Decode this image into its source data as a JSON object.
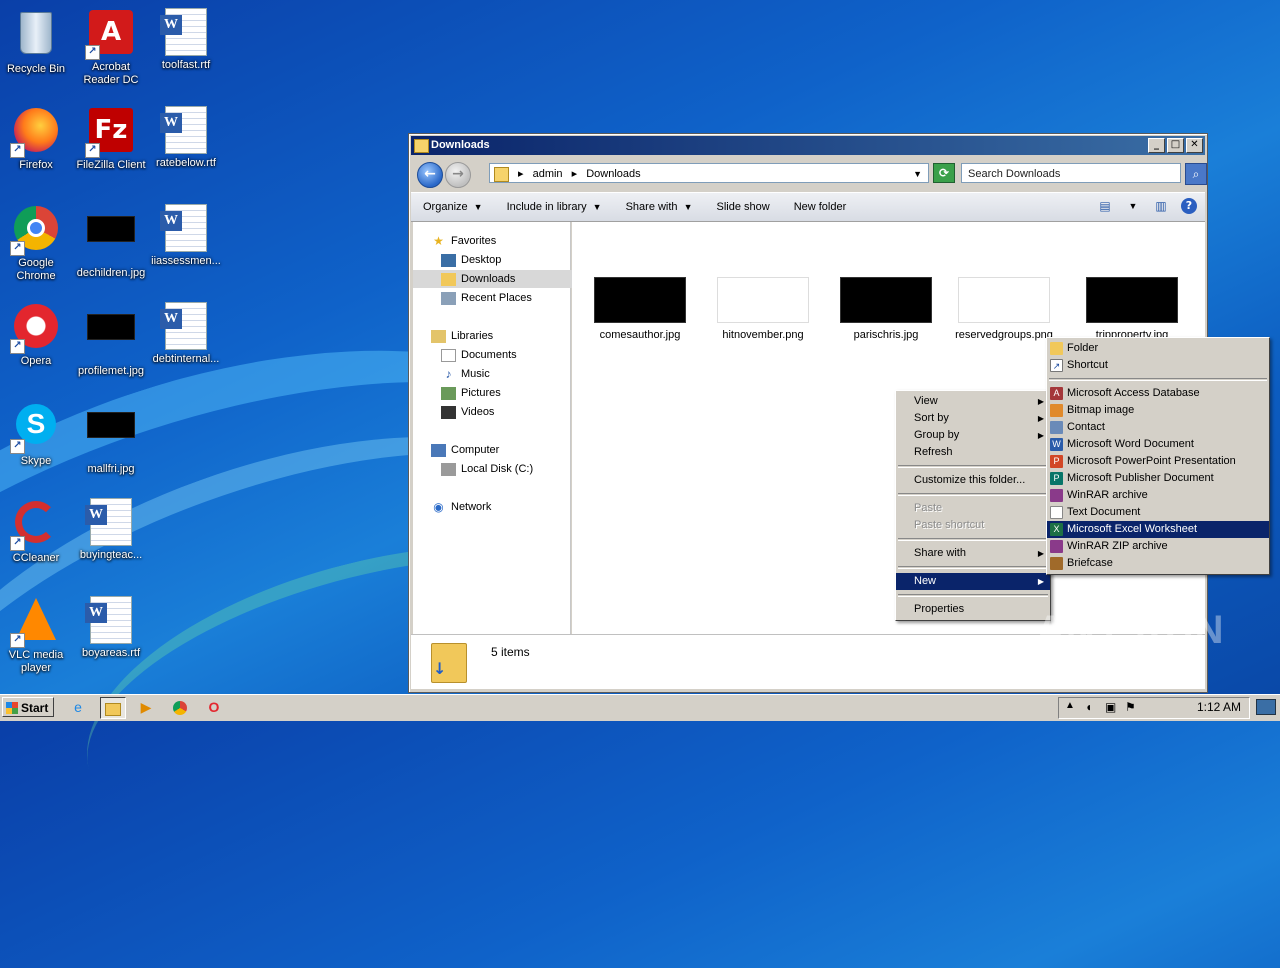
{
  "desktop": {
    "icons": [
      {
        "label": "Recycle Bin"
      },
      {
        "label": "Acrobat Reader DC"
      },
      {
        "label": "toolfast.rtf"
      },
      {
        "label": "Firefox"
      },
      {
        "label": "FileZilla Client"
      },
      {
        "label": "ratebelow.rtf"
      },
      {
        "label": "Google Chrome"
      },
      {
        "label": "dechildren.jpg"
      },
      {
        "label": "iiassessmen..."
      },
      {
        "label": "Opera"
      },
      {
        "label": "profilemet.jpg"
      },
      {
        "label": "debtinternal..."
      },
      {
        "label": "Skype"
      },
      {
        "label": "mallfri.jpg"
      },
      {
        "label": "CCleaner"
      },
      {
        "label": "buyingteac..."
      },
      {
        "label": "VLC media player"
      },
      {
        "label": "boyareas.rtf"
      }
    ],
    "watermark": "ANY RUN"
  },
  "window": {
    "title": "Downloads",
    "controls": {
      "minimize": "_",
      "maximize": "□",
      "close": "✕"
    },
    "address": {
      "crumbs": [
        "admin",
        "Downloads"
      ],
      "separator": "▸"
    },
    "search_placeholder": "Search Downloads",
    "toolbar": {
      "organize": "Organize",
      "include": "Include in library",
      "share": "Share with",
      "slideshow": "Slide show",
      "newfolder": "New folder"
    },
    "nav": {
      "favorites": "Favorites",
      "desktop": "Desktop",
      "downloads": "Downloads",
      "recent": "Recent Places",
      "libraries": "Libraries",
      "documents": "Documents",
      "music": "Music",
      "pictures": "Pictures",
      "videos": "Videos",
      "computer": "Computer",
      "localdisk": "Local Disk (C:)",
      "network": "Network"
    },
    "files": [
      {
        "name": "comesauthor.jpg",
        "thumb": "black"
      },
      {
        "name": "hitnovember.png",
        "thumb": "white"
      },
      {
        "name": "parischris.jpg",
        "thumb": "black"
      },
      {
        "name": "reservedgroups.png",
        "thumb": "white"
      },
      {
        "name": "tripproperty.jpg",
        "thumb": "black"
      }
    ],
    "status": "5 items"
  },
  "context_menu": {
    "view": "View",
    "sortby": "Sort by",
    "groupby": "Group by",
    "refresh": "Refresh",
    "customize": "Customize this folder...",
    "paste": "Paste",
    "paste_shortcut": "Paste shortcut",
    "share_with": "Share with",
    "new": "New",
    "properties": "Properties"
  },
  "new_submenu": {
    "folder": "Folder",
    "shortcut": "Shortcut",
    "access": "Microsoft Access Database",
    "bitmap": "Bitmap image",
    "contact": "Contact",
    "word": "Microsoft Word Document",
    "powerpoint": "Microsoft PowerPoint Presentation",
    "publisher": "Microsoft Publisher Document",
    "winrar": "WinRAR archive",
    "text": "Text Document",
    "excel": "Microsoft Excel Worksheet",
    "winrarzip": "WinRAR ZIP archive",
    "briefcase": "Briefcase"
  },
  "taskbar": {
    "start": "Start",
    "clock": "1:12 AM"
  }
}
